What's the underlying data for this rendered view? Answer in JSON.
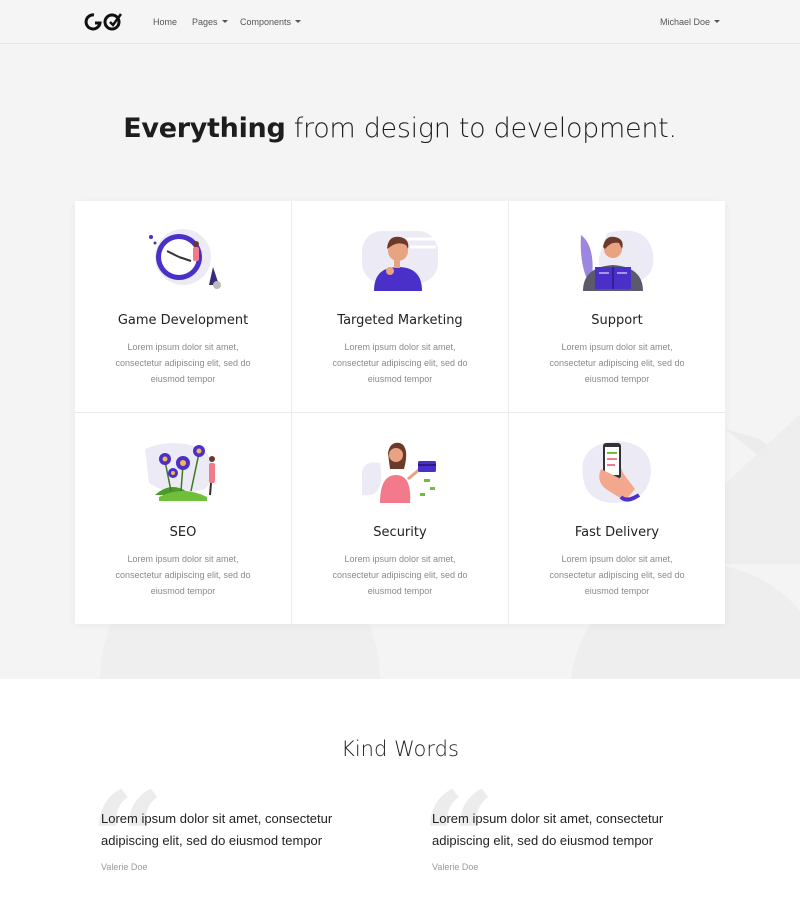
{
  "navbar": {
    "logo_text": "GO",
    "links": [
      {
        "label": "Home"
      },
      {
        "label": "Pages"
      },
      {
        "label": "Components"
      }
    ],
    "user": "Michael Doe"
  },
  "hero": {
    "title_bold": "Everything",
    "title_rest": " from design to development."
  },
  "features": [
    {
      "title": "Game Development",
      "text": "Lorem ipsum dolor sit amet, consectetur adipiscing elit, sed do eiusmod tempor",
      "icon": "clock-illustration"
    },
    {
      "title": "Targeted Marketing",
      "text": "Lorem ipsum dolor sit amet, consectetur adipiscing elit, sed do eiusmod tempor",
      "icon": "person-thinking-illustration"
    },
    {
      "title": "Support",
      "text": "Lorem ipsum dolor sit amet, consectetur adipiscing elit, sed do eiusmod tempor",
      "icon": "person-reading-illustration"
    },
    {
      "title": "SEO",
      "text": "Lorem ipsum dolor sit amet, consectetur adipiscing elit, sed do eiusmod tempor",
      "icon": "flowers-illustration"
    },
    {
      "title": "Security",
      "text": "Lorem ipsum dolor sit amet, consectetur adipiscing elit, sed do eiusmod tempor",
      "icon": "woman-with-card-illustration"
    },
    {
      "title": "Fast Delivery",
      "text": "Lorem ipsum dolor sit amet, consectetur adipiscing elit, sed do eiusmod tempor",
      "icon": "phone-in-hand-illustration"
    }
  ],
  "testimonials": {
    "title": "Kind Words",
    "quote_mark": "“",
    "items": [
      {
        "quote": "Lorem ipsum dolor sit amet, consectetur adipiscing elit, sed do eiusmod tempor",
        "author": "Valerie Doe"
      },
      {
        "quote": "Lorem ipsum dolor sit amet, consectetur adipiscing elit, sed do eiusmod tempor",
        "author": "Valerie Doe"
      }
    ]
  },
  "colors": {
    "accent": "#4b2fc9",
    "pink": "#f27a8a",
    "navbar_bg": "#f5f5f5",
    "hero_bg": "#f4f4f4"
  }
}
